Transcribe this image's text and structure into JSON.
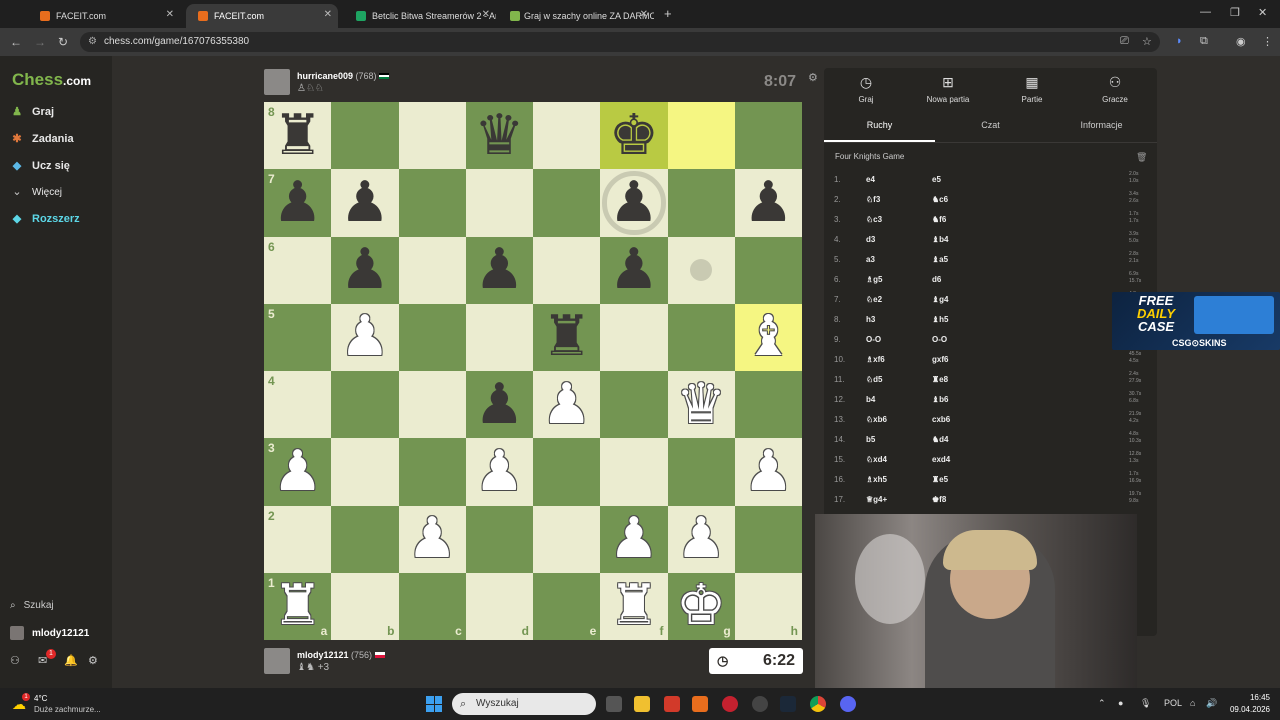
{
  "browser": {
    "tabs": [
      {
        "label": "FACEIT.com",
        "color": "#e86d1d"
      },
      {
        "label": "FACEIT.com",
        "color": "#e86d1d"
      },
      {
        "label": "Betclic Bitwa Streamerów 2 - Ar",
        "color": "#1ea462"
      },
      {
        "label": "Graj w szachy online ZA DARMO",
        "color": "#81b64c"
      }
    ],
    "url": "chess.com/game/167076355380"
  },
  "sidebar": {
    "logo_a": "Chess",
    "logo_b": ".com",
    "items": [
      {
        "label": "Graj",
        "icon": "pawn-icon",
        "glyph": "♟",
        "color": "#81b64c"
      },
      {
        "label": "Zadania",
        "icon": "puzzle-icon",
        "glyph": "✱",
        "color": "#e0783c"
      },
      {
        "label": "Ucz się",
        "icon": "learn-icon",
        "glyph": "◆",
        "color": "#5cb8e6"
      },
      {
        "label": "Więcej",
        "icon": "chevron-down-icon",
        "glyph": "⌄",
        "color": "#ccc"
      },
      {
        "label": "Rozszerz",
        "icon": "diamond-icon",
        "glyph": "◆",
        "color": "#5cd6e6"
      }
    ],
    "search_label": "Szukaj",
    "username": "mlody12121",
    "mail_badge": "1"
  },
  "game": {
    "top_player": {
      "name": "hurricane009",
      "rating": "(768)"
    },
    "bottom_player": {
      "name": "mlody12121",
      "rating": "(756)",
      "captured_extra": "+3"
    },
    "top_clock": "8:07",
    "bottom_clock": "6:22",
    "board": [
      [
        "b-rook",
        "",
        "",
        "b-queen",
        "",
        "b-king",
        "",
        ""
      ],
      [
        "b-pawn",
        "b-pawn",
        "",
        "",
        "",
        "b-pawn",
        "",
        "b-pawn"
      ],
      [
        "",
        "b-pawn",
        "",
        "b-pawn",
        "",
        "b-pawn",
        "",
        ""
      ],
      [
        "",
        "w-pawn",
        "",
        "",
        "b-rook",
        "",
        "",
        "w-bishop"
      ],
      [
        "",
        "",
        "",
        "b-pawn",
        "w-pawn",
        "",
        "w-queen",
        ""
      ],
      [
        "w-pawn",
        "",
        "",
        "w-pawn",
        "",
        "",
        "",
        "w-pawn"
      ],
      [
        "",
        "",
        "w-pawn",
        "",
        "",
        "w-pawn",
        "w-pawn",
        ""
      ],
      [
        "w-rook",
        "",
        "",
        "",
        "",
        "w-rook",
        "w-king",
        ""
      ]
    ],
    "highlight_squares": [
      "f8",
      "g8",
      "h5"
    ],
    "ranks": [
      "8",
      "7",
      "6",
      "5",
      "4",
      "3",
      "2",
      "1"
    ],
    "files": [
      "a",
      "b",
      "c",
      "d",
      "e",
      "f",
      "g",
      "h"
    ]
  },
  "panel": {
    "top_tabs": [
      {
        "label": "Graj",
        "icon": "clock-icon",
        "glyph": "◷"
      },
      {
        "label": "Nowa partia",
        "icon": "plus-icon",
        "glyph": "⊞"
      },
      {
        "label": "Partie",
        "icon": "board-icon",
        "glyph": "▦"
      },
      {
        "label": "Gracze",
        "icon": "players-icon",
        "glyph": "👥"
      }
    ],
    "sub_tabs": [
      "Ruchy",
      "Czat",
      "Informacje"
    ],
    "opening": "Four Knights Game",
    "moves": [
      {
        "n": "1.",
        "w": "e4",
        "b": "e5",
        "tw": "2.0s",
        "tb": "1.0s"
      },
      {
        "n": "2.",
        "w": "♘f3",
        "b": "♞c6",
        "tw": "3.4s",
        "tb": "2.6s"
      },
      {
        "n": "3.",
        "w": "♘c3",
        "b": "♞f6",
        "tw": "1.7s",
        "tb": "1.7s"
      },
      {
        "n": "4.",
        "w": "d3",
        "b": "♝b4",
        "tw": "3.9s",
        "tb": "5.0s"
      },
      {
        "n": "5.",
        "w": "a3",
        "b": "♝a5",
        "tw": "2.8s",
        "tb": "2.1s"
      },
      {
        "n": "6.",
        "w": "♗g5",
        "b": "d6",
        "tw": "6.9s",
        "tb": "15.7s"
      },
      {
        "n": "7.",
        "w": "♘e2",
        "b": "♝g4",
        "tw": "4.3s",
        "tb": "1.7s"
      },
      {
        "n": "8.",
        "w": "h3",
        "b": "♝h5",
        "tw": "1.3s",
        "tb": "2.5s"
      },
      {
        "n": "9.",
        "w": "O-O",
        "b": "O-O",
        "tw": "2.3s",
        "tb": "3.0s"
      },
      {
        "n": "10.",
        "w": "♗xf6",
        "b": "gxf6",
        "tw": "45.5s",
        "tb": "4.5s"
      },
      {
        "n": "11.",
        "w": "♘d5",
        "b": "♜e8",
        "tw": "2.4s",
        "tb": "27.9s"
      },
      {
        "n": "12.",
        "w": "b4",
        "b": "♝b6",
        "tw": "30.7s",
        "tb": "6.8s"
      },
      {
        "n": "13.",
        "w": "♘xb6",
        "b": "cxb6",
        "tw": "21.9s",
        "tb": "4.2s"
      },
      {
        "n": "14.",
        "w": "b5",
        "b": "♞d4",
        "tw": "4.8s",
        "tb": "10.3s"
      },
      {
        "n": "15.",
        "w": "♘xd4",
        "b": "exd4",
        "tw": "12.8s",
        "tb": "1.3s"
      },
      {
        "n": "16.",
        "w": "♗xh5",
        "b": "♜e5",
        "tw": "1.7s",
        "tb": "16.9s"
      },
      {
        "n": "17.",
        "w": "♕g4+",
        "b": "♚f8",
        "tw": "19.7s",
        "tb": "9.8s"
      }
    ]
  },
  "ad": {
    "line1": "FREE",
    "line2": "DAILY",
    "line3": "CASE",
    "brand": "CSG⊙SKINS"
  },
  "taskbar": {
    "weather_temp": "4°C",
    "weather_desc": "Duże zachmurze...",
    "search_placeholder": "Wyszukaj",
    "lang": "POL",
    "time": "16:45",
    "date": "09.04.2026"
  }
}
